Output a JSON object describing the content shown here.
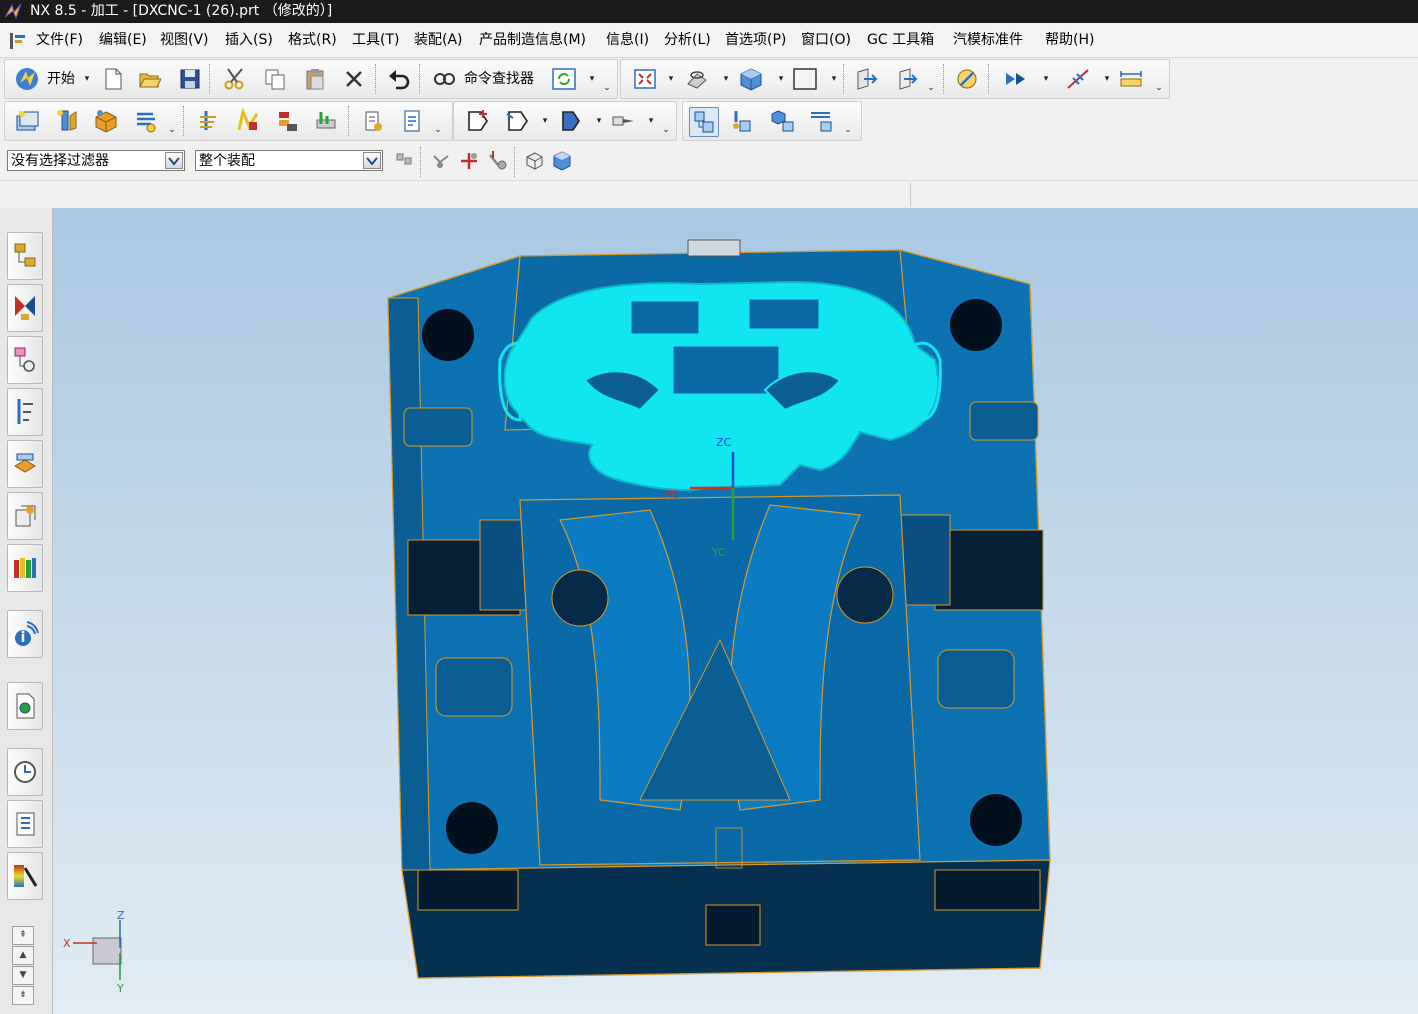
{
  "window": {
    "title": "NX 8.5 - 加工 - [DXCNC-1 (26).prt （修改的）]"
  },
  "menu": [
    "文件(F)",
    "编辑(E)",
    "视图(V)",
    "插入(S)",
    "格式(R)",
    "工具(T)",
    "装配(A)",
    "产品制造信息(M)",
    "信息(I)",
    "分析(L)",
    "首选项(P)",
    "窗口(O)",
    "GC 工具箱",
    "汽模标准件",
    "帮助(H)"
  ],
  "toolbar": {
    "start_label": "开始",
    "command_finder_label": "命令查找器"
  },
  "selection": {
    "filter_value": "没有选择过滤器",
    "scope_value": "整个装配"
  },
  "viewport": {
    "wcs_labels": {
      "zc": "ZC",
      "xc": "XC",
      "yc": "YC"
    },
    "triad_labels": {
      "x": "X",
      "y": "Y",
      "z": "Z"
    }
  },
  "colors": {
    "model_body": "#0a6fae",
    "highlight": "#11e6f0",
    "edges": "#e8a020",
    "background_top": "#a9c8e2",
    "background_bottom": "#e2ecf4"
  }
}
